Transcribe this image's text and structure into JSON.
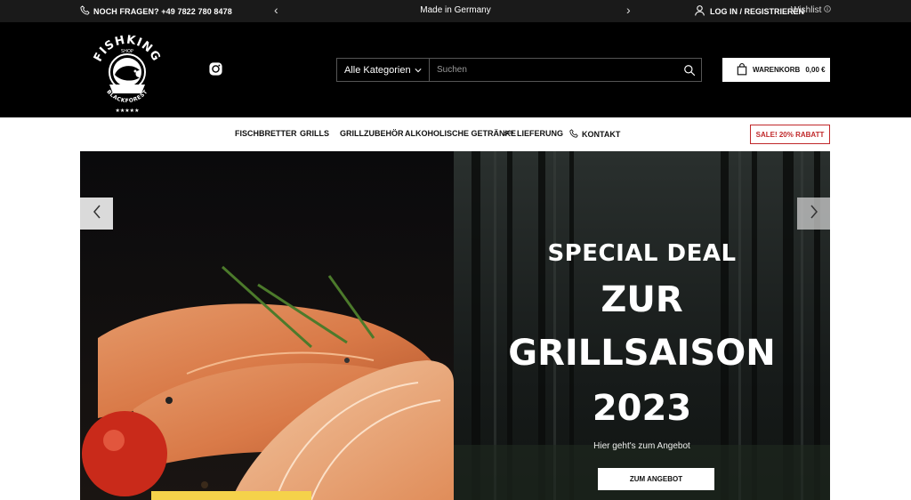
{
  "topbar": {
    "phone": "NOCH FRAGEN? +49 7822 780 8478",
    "promo": "Made in Germany",
    "login": "LOG IN / REGISTRIEREN",
    "wishlist": "Wishlist"
  },
  "header": {
    "logo_text": "FISHKING",
    "logo_sub": "SHOP",
    "logo_bottom": "BLACKFOREST",
    "search": {
      "category": "Alle Kategorien",
      "placeholder": "Suchen"
    },
    "cart": {
      "label": "WARENKORB",
      "amount": "0,00 €"
    }
  },
  "nav": {
    "items": [
      "FISCHBRETTER",
      "GRILLS",
      "GRILLZUBEHÖR",
      "ALKOHOLISCHE GETRÄNKE",
      "LIEFERUNG",
      "KONTAKT"
    ],
    "sale": "SALE! 20% RABATT"
  },
  "hero": {
    "line1": "SPECIAL DEAL",
    "line2": "ZUR",
    "line3": "GRILLSAISON",
    "line4": "2023",
    "sub": "Hier geht's zum Angebot",
    "button": "ZUM ANGEBOT"
  },
  "colors": {
    "sale_red": "#c0282a",
    "header_bg": "#000000",
    "topbar_bg": "#1a1a1a"
  }
}
